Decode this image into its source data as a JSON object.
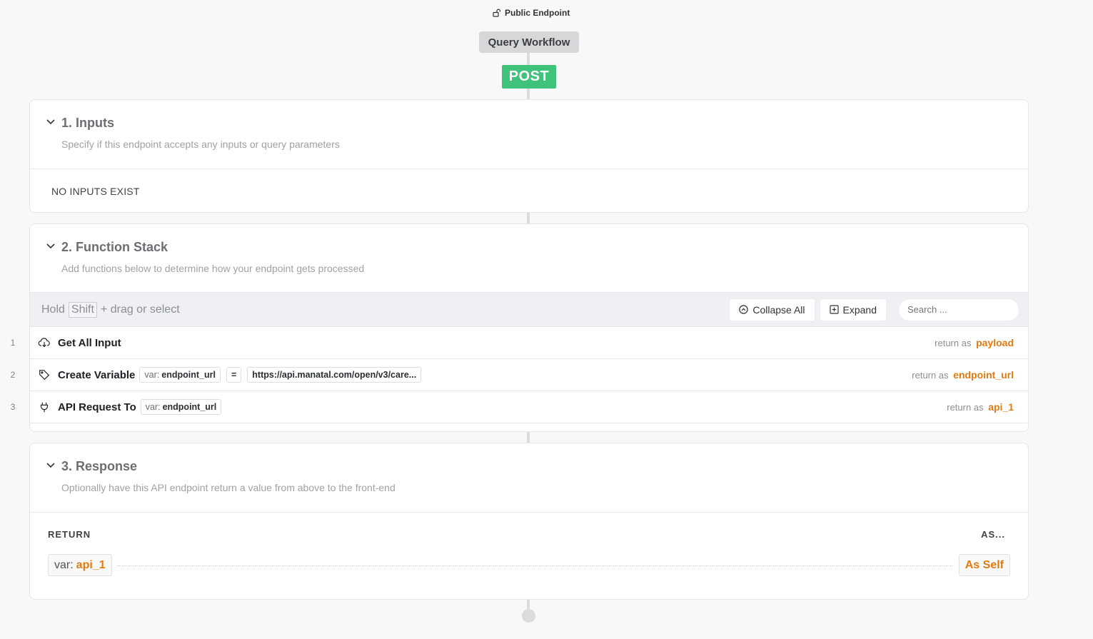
{
  "header": {
    "public_endpoint_label": "Public Endpoint",
    "workflow_badge": "Query Workflow",
    "method_badge": "POST"
  },
  "inputs_section": {
    "title": "1. Inputs",
    "subtitle": "Specify if this endpoint accepts any inputs or query parameters",
    "empty_text": "NO INPUTS EXIST"
  },
  "function_stack": {
    "title": "2. Function Stack",
    "subtitle": "Add functions below to determine how your endpoint gets processed",
    "toolbar": {
      "hint_prefix": "Hold",
      "hint_key": "Shift",
      "hint_suffix": "+ drag or select",
      "collapse_all": "Collapse All",
      "expand": "Expand",
      "search_placeholder": "Search ..."
    },
    "return_as_label": "return as",
    "rows": [
      {
        "number": "1",
        "icon": "cloud-download-icon",
        "name": "Get All Input",
        "return_var": "payload"
      },
      {
        "number": "2",
        "icon": "tag-icon",
        "name": "Create Variable",
        "var_prefix": "var:",
        "var_name": "endpoint_url",
        "operator": "=",
        "value": "https://api.manatal.com/open/v3/care...",
        "return_var": "endpoint_url"
      },
      {
        "number": "3",
        "icon": "plug-icon",
        "name": "API Request To",
        "var_prefix": "var:",
        "var_name": "endpoint_url",
        "return_var": "api_1"
      }
    ]
  },
  "response_section": {
    "title": "3. Response",
    "subtitle": "Optionally have this API endpoint return a value from above to the front-end",
    "return_label": "RETURN",
    "as_label": "AS...",
    "var_prefix": "var:",
    "var_name": "api_1",
    "as_value": "As Self"
  },
  "colors": {
    "post_green": "#3fc37a",
    "accent_orange": "#e07b12"
  }
}
